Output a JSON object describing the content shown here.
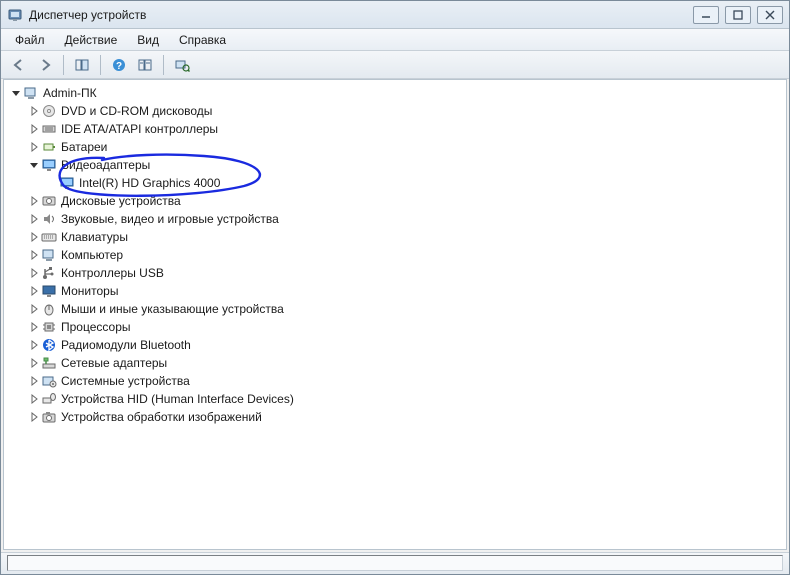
{
  "window": {
    "title": "Диспетчер устройств"
  },
  "menu": {
    "file": "Файл",
    "action": "Действие",
    "view": "Вид",
    "help": "Справка"
  },
  "tree": {
    "root": "Admin-ПК",
    "items": [
      {
        "label": "DVD и CD-ROM дисководы",
        "icon": "disc"
      },
      {
        "label": "IDE ATA/ATAPI контроллеры",
        "icon": "ide"
      },
      {
        "label": "Батареи",
        "icon": "battery"
      },
      {
        "label": "Видеоадаптеры",
        "icon": "display",
        "expanded": true,
        "children": [
          {
            "label": "Intel(R) HD Graphics 4000",
            "icon": "display"
          }
        ]
      },
      {
        "label": "Дисковые устройства",
        "icon": "hdd"
      },
      {
        "label": "Звуковые, видео и игровые устройства",
        "icon": "audio"
      },
      {
        "label": "Клавиатуры",
        "icon": "keyboard"
      },
      {
        "label": "Компьютер",
        "icon": "computer"
      },
      {
        "label": "Контроллеры USB",
        "icon": "usb"
      },
      {
        "label": "Мониторы",
        "icon": "monitor"
      },
      {
        "label": "Мыши и иные указывающие устройства",
        "icon": "mouse"
      },
      {
        "label": "Процессоры",
        "icon": "cpu"
      },
      {
        "label": "Радиомодули Bluetooth",
        "icon": "bluetooth"
      },
      {
        "label": "Сетевые адаптеры",
        "icon": "network"
      },
      {
        "label": "Системные устройства",
        "icon": "system"
      },
      {
        "label": "Устройства HID (Human Interface Devices)",
        "icon": "hid"
      },
      {
        "label": "Устройства обработки изображений",
        "icon": "imaging"
      }
    ]
  }
}
